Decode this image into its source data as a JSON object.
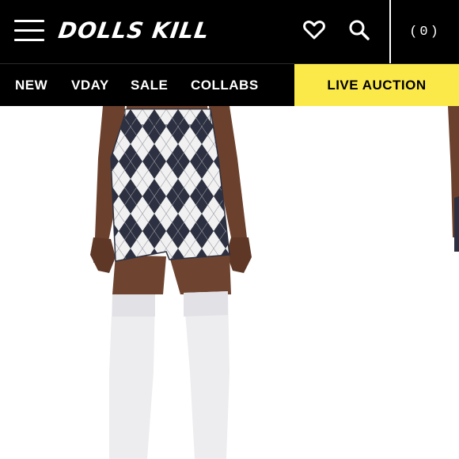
{
  "header": {
    "logo": "DOLLS KILL",
    "cart_count": "(0)"
  },
  "icons": [
    "menu-icon",
    "heart-icon",
    "search-icon"
  ],
  "nav": {
    "items": [
      {
        "label": "NEW"
      },
      {
        "label": "VDAY"
      },
      {
        "label": "SALE"
      },
      {
        "label": "COLLABS"
      }
    ],
    "live_auction": "LIVE AUCTION"
  },
  "colors": {
    "header_bg": "#000000",
    "accent": "#fbe94a",
    "text_light": "#ffffff"
  }
}
